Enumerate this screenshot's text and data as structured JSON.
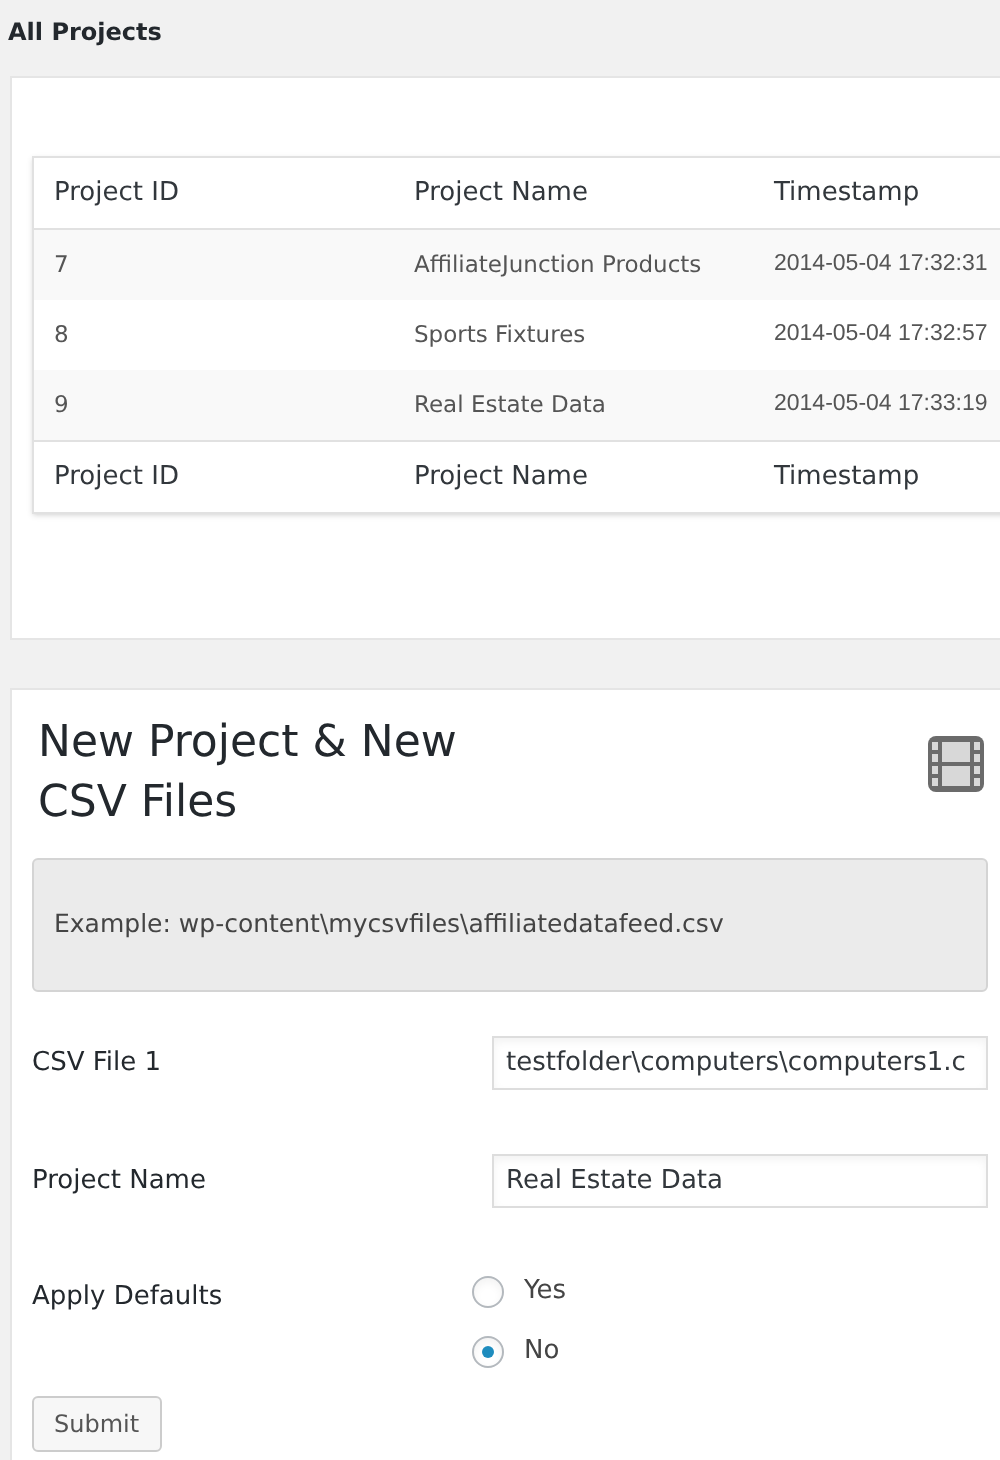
{
  "page_title": "All Projects",
  "table": {
    "columns": [
      "Project ID",
      "Project Name",
      "Timestamp"
    ],
    "rows": [
      {
        "cells": [
          "7",
          "AffiliateJunction Products",
          "2014-05-04 17:32:31"
        ]
      },
      {
        "cells": [
          "8",
          "Sports Fixtures",
          "2014-05-04 17:32:57"
        ]
      },
      {
        "cells": [
          "9",
          "Real Estate Data",
          "2014-05-04 17:33:19"
        ]
      }
    ],
    "footer": [
      "Project ID",
      "Project Name",
      "Timestamp"
    ]
  },
  "form": {
    "title": "New Project & New CSV Files",
    "notice": "Example: wp-content\\mycsvfiles\\affiliatedatafeed.csv",
    "fields": [
      {
        "kind": "text",
        "label": "CSV File 1",
        "value": "testfolder\\computers\\computers1.c"
      },
      {
        "kind": "text",
        "label": "Project Name",
        "value": "Real Estate Data"
      },
      {
        "kind": "radio",
        "label": "Apply Defaults",
        "options": [
          {
            "label": "Yes",
            "selected": false
          },
          {
            "label": "No",
            "selected": true
          }
        ]
      }
    ],
    "submit": "Submit"
  }
}
